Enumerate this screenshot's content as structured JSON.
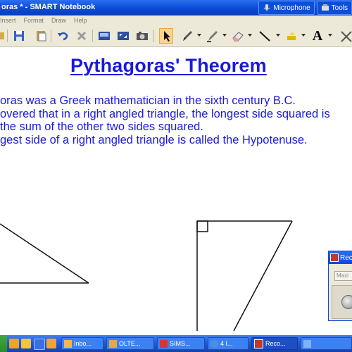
{
  "window": {
    "title": "oras * - SMART Notebook",
    "buttons": [
      {
        "label": "Microphone"
      },
      {
        "label": "Tools"
      }
    ]
  },
  "menu": {
    "items": [
      "Insert",
      "Format",
      "Draw",
      "Help"
    ]
  },
  "toolbar": {
    "tools": [
      "save-icon",
      "paste-icon",
      "undo-icon",
      "delete-icon",
      "screen-shade-icon",
      "full-screen-icon",
      "capture-icon",
      "select-arrow-icon",
      "pen-icon",
      "creative-pen-icon",
      "eraser-icon",
      "line-icon",
      "fill-icon",
      "text-icon"
    ],
    "text_tool_glyph": "A"
  },
  "page": {
    "title": "Pythagoras' Theorem",
    "lines": [
      "oras was a Greek mathematician in the sixth century B.C.",
      "overed that in a right angled triangle, the longest side squared is",
      "the sum of the other two sides squared.",
      "gest side of a right angled triangle is called the Hypotenuse."
    ]
  },
  "recorder": {
    "title": "Rec",
    "field_text": "Maxi"
  },
  "taskbar": {
    "tasks": [
      {
        "label": "Inbo..."
      },
      {
        "label": "OLTE..."
      },
      {
        "label": "SIMS..."
      },
      {
        "label": "4 I..."
      },
      {
        "label": "Reco..."
      }
    ]
  },
  "colors": {
    "text_blue": "#1a1adc",
    "titlebar_blue": "#0a49d6",
    "toolbar_bg": "#ece9d8"
  }
}
